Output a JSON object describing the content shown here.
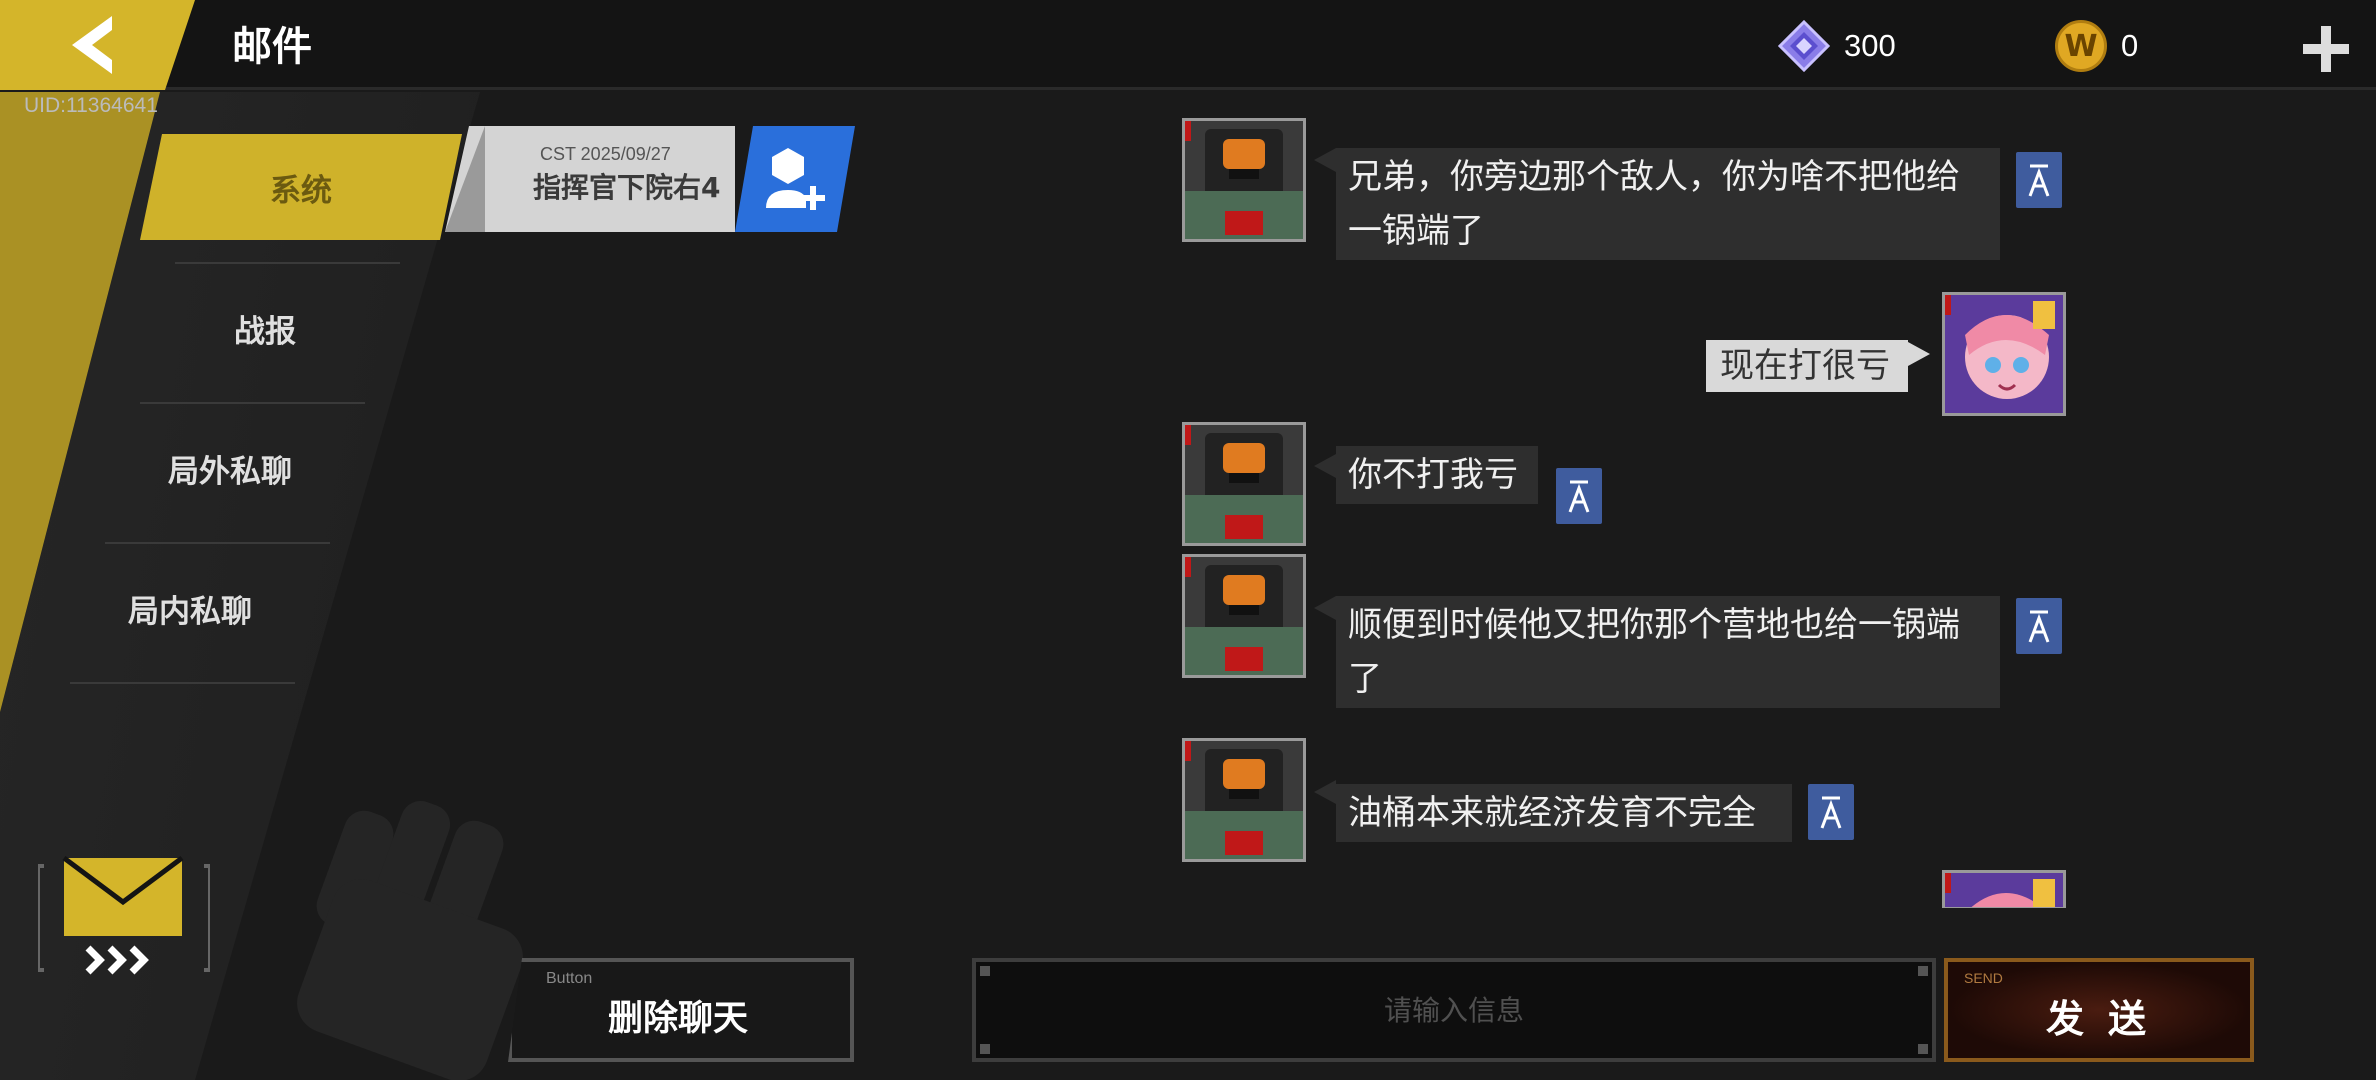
{
  "header": {
    "title": "邮件",
    "uid": "UID:11364641",
    "gem_count": "300",
    "coin_count": "0",
    "coin_symbol": "W"
  },
  "tabs": [
    {
      "label": "系统",
      "active": true
    },
    {
      "label": "战报",
      "active": false
    },
    {
      "label": "局外私聊",
      "active": false
    },
    {
      "label": "局内私聊",
      "active": false
    }
  ],
  "contact": {
    "date": "CST 2025/09/27",
    "name": "指挥官下院右4"
  },
  "messages": [
    {
      "sender": "other",
      "text": "兄弟，你旁边那个敌人，你为啥不把他给一锅端了"
    },
    {
      "sender": "self",
      "text": "现在打很亏"
    },
    {
      "sender": "other",
      "text": "你不打我亏"
    },
    {
      "sender": "other",
      "text": "顺便到时候他又把你那个营地也给一锅端了"
    },
    {
      "sender": "other",
      "text": "油桶本来就经济发育不完全"
    }
  ],
  "bottom": {
    "delete_tag": "Button",
    "delete_label": "删除聊天",
    "input_placeholder": "请输入信息",
    "send_tag": "SEND",
    "send_label": "发送"
  },
  "colors": {
    "accent_yellow": "#cfb22a",
    "accent_blue": "#2a6fdb",
    "translate_blue": "#3f5c9e"
  },
  "icons": {
    "back": "back-arrow-icon",
    "gem": "gem-icon",
    "coin": "coin-icon",
    "plus": "plus-icon",
    "add_friend": "add-friend-icon",
    "translate": "translate-icon",
    "mail": "mail-icon"
  }
}
